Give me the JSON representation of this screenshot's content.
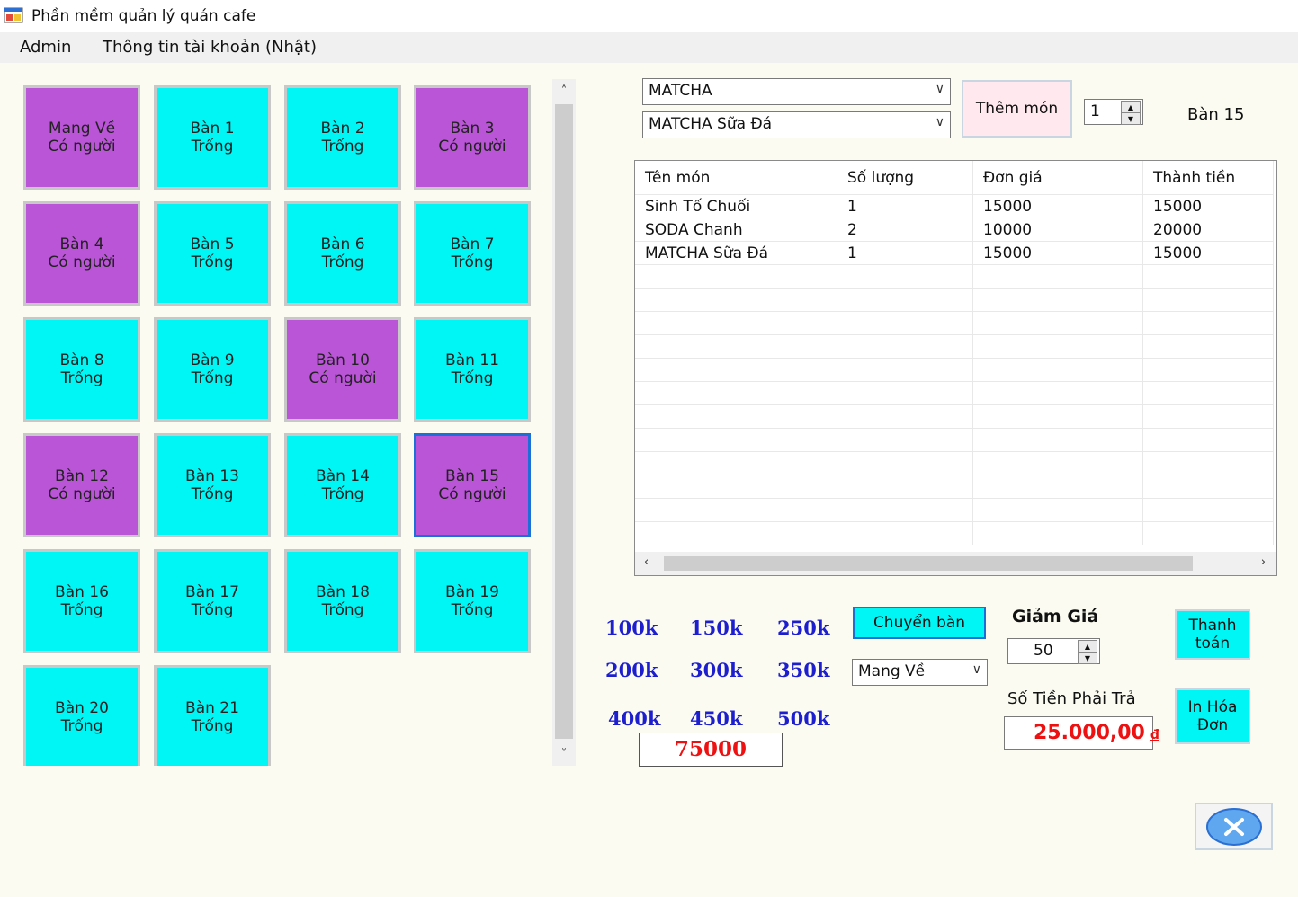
{
  "window": {
    "title": "Phần mềm quản lý quán cafe",
    "icon": "app-window-icon"
  },
  "menu": {
    "items": [
      "Admin",
      "Thông tin tài khoản (Nhật)"
    ]
  },
  "tables": [
    {
      "name": "Mang Về",
      "status": "Có người",
      "busy": true
    },
    {
      "name": "Bàn 1",
      "status": "Trống",
      "busy": false
    },
    {
      "name": "Bàn 2",
      "status": "Trống",
      "busy": false
    },
    {
      "name": "Bàn 3",
      "status": "Có người",
      "busy": true
    },
    {
      "name": "Bàn 4",
      "status": "Có người",
      "busy": true
    },
    {
      "name": "Bàn 5",
      "status": "Trống",
      "busy": false
    },
    {
      "name": "Bàn 6",
      "status": "Trống",
      "busy": false
    },
    {
      "name": "Bàn 7",
      "status": "Trống",
      "busy": false
    },
    {
      "name": "Bàn 8",
      "status": "Trống",
      "busy": false
    },
    {
      "name": "Bàn 9",
      "status": "Trống",
      "busy": false
    },
    {
      "name": "Bàn 10",
      "status": "Có người",
      "busy": true
    },
    {
      "name": "Bàn 11",
      "status": "Trống",
      "busy": false
    },
    {
      "name": "Bàn 12",
      "status": "Có người",
      "busy": true
    },
    {
      "name": "Bàn 13",
      "status": "Trống",
      "busy": false
    },
    {
      "name": "Bàn 14",
      "status": "Trống",
      "busy": false
    },
    {
      "name": "Bàn 15",
      "status": "Có người",
      "busy": true,
      "selected": true
    },
    {
      "name": "Bàn 16",
      "status": "Trống",
      "busy": false
    },
    {
      "name": "Bàn 17",
      "status": "Trống",
      "busy": false
    },
    {
      "name": "Bàn 18",
      "status": "Trống",
      "busy": false
    },
    {
      "name": "Bàn 19",
      "status": "Trống",
      "busy": false
    },
    {
      "name": "Bàn 20",
      "status": "Trống",
      "busy": false
    },
    {
      "name": "Bàn 21",
      "status": "Trống",
      "busy": false
    }
  ],
  "colors": {
    "empty": "#00f5f5",
    "busy": "#bb55d8",
    "selected_border": "#1b6fd6",
    "money_text": "#1d1fcf",
    "total_text": "#ee1111"
  },
  "order": {
    "category": "MATCHA",
    "item": "MATCHA Sữa Đá",
    "add_button": "Thêm món",
    "quantity": "1",
    "current_table": "Bàn 15"
  },
  "bill": {
    "columns": [
      "Tên món",
      "Số lượng",
      "Đơn giá",
      "Thành tiền"
    ],
    "rows": [
      [
        "Sinh Tố Chuối",
        "1",
        "15000",
        "15000"
      ],
      [
        "SODA Chanh",
        "2",
        "10000",
        "20000"
      ],
      [
        "MATCHA Sữa Đá",
        "1",
        "15000",
        "15000"
      ]
    ]
  },
  "cash": {
    "buttons": [
      "100k",
      "150k",
      "250k",
      "200k",
      "300k",
      "350k",
      "400k",
      "450k",
      "500k"
    ],
    "total": "75000"
  },
  "actions": {
    "switch_table": "Chuyển bàn",
    "switch_target": "Mang Về",
    "discount_label": "Giảm Giá",
    "discount_value": "50",
    "pay_label": "Số Tiền Phải Trả",
    "pay_amount": "25.000,00",
    "currency": "đ",
    "checkout": "Thanh toán",
    "print": "In Hóa Đơn",
    "close_icon": "close-icon"
  }
}
